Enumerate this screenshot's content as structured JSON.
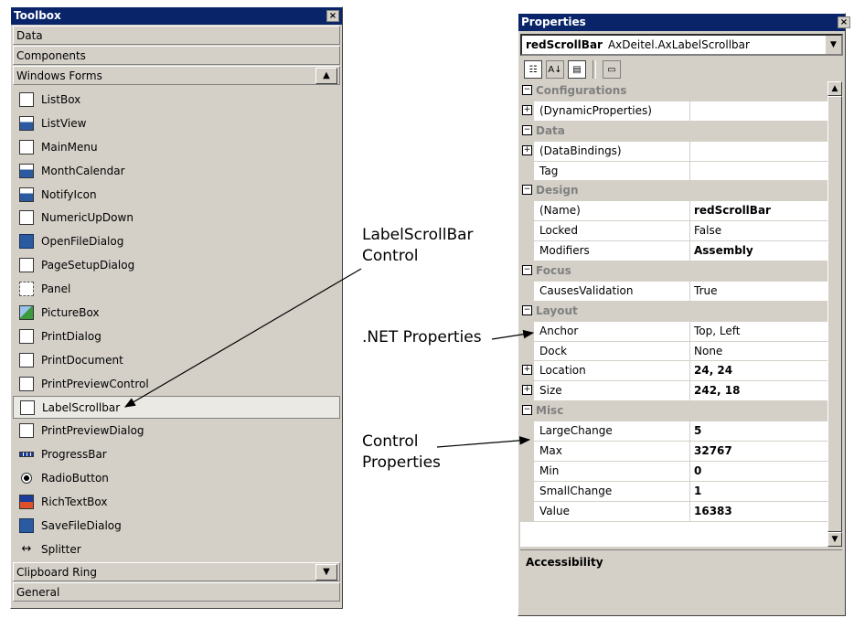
{
  "toolbox": {
    "title": "Toolbox",
    "close_glyph": "×",
    "tabs_top": [
      "Data",
      "Components",
      "Windows Forms"
    ],
    "items": [
      {
        "label": "ListBox",
        "icon": "listbox-icon"
      },
      {
        "label": "ListView",
        "icon": "listview-icon"
      },
      {
        "label": "MainMenu",
        "icon": "mainmenu-icon"
      },
      {
        "label": "MonthCalendar",
        "icon": "monthcalendar-icon"
      },
      {
        "label": "NotifyIcon",
        "icon": "notifyicon-icon"
      },
      {
        "label": "NumericUpDown",
        "icon": "numericupdown-icon"
      },
      {
        "label": "OpenFileDialog",
        "icon": "openfiledialog-icon"
      },
      {
        "label": "PageSetupDialog",
        "icon": "pagesetupdialog-icon"
      },
      {
        "label": "Panel",
        "icon": "panel-icon"
      },
      {
        "label": "PictureBox",
        "icon": "picturebox-icon"
      },
      {
        "label": "PrintDialog",
        "icon": "printdialog-icon"
      },
      {
        "label": "PrintDocument",
        "icon": "printdocument-icon"
      },
      {
        "label": "PrintPreviewControl",
        "icon": "printpreviewcontrol-icon"
      },
      {
        "label": "LabelScrollbar",
        "icon": "labelscrollbar-icon",
        "selected": true
      },
      {
        "label": "PrintPreviewDialog",
        "icon": "printpreviewdialog-icon"
      },
      {
        "label": "ProgressBar",
        "icon": "progressbar-icon"
      },
      {
        "label": "RadioButton",
        "icon": "radiobutton-icon"
      },
      {
        "label": "RichTextBox",
        "icon": "richtextbox-icon"
      },
      {
        "label": "SaveFileDialog",
        "icon": "savefiledialog-icon"
      },
      {
        "label": "Splitter",
        "icon": "splitter-icon"
      }
    ],
    "tabs_bottom": [
      "Clipboard Ring",
      "General"
    ]
  },
  "properties": {
    "title": "Properties",
    "close_glyph": "×",
    "object_name": "redScrollBar",
    "object_type": "AxDeitel.AxLabelScrollbar",
    "rows": [
      {
        "type": "cat",
        "name": "Configurations",
        "sign": "⊟"
      },
      {
        "type": "prop",
        "name": "(DynamicProperties)",
        "value": "",
        "sign": "⊞"
      },
      {
        "type": "cat",
        "name": "Data",
        "sign": "⊟"
      },
      {
        "type": "prop",
        "name": "(DataBindings)",
        "value": "",
        "sign": "⊞"
      },
      {
        "type": "prop",
        "name": "Tag",
        "value": ""
      },
      {
        "type": "cat",
        "name": "Design",
        "sign": "⊟"
      },
      {
        "type": "prop",
        "name": "(Name)",
        "value": "redScrollBar",
        "bold": true
      },
      {
        "type": "prop",
        "name": "Locked",
        "value": "False"
      },
      {
        "type": "prop",
        "name": "Modifiers",
        "value": "Assembly",
        "bold": true
      },
      {
        "type": "cat",
        "name": "Focus",
        "sign": "⊟"
      },
      {
        "type": "prop",
        "name": "CausesValidation",
        "value": "True"
      },
      {
        "type": "cat",
        "name": "Layout",
        "sign": "⊟"
      },
      {
        "type": "prop",
        "name": "Anchor",
        "value": "Top, Left"
      },
      {
        "type": "prop",
        "name": "Dock",
        "value": "None"
      },
      {
        "type": "prop",
        "name": "Location",
        "value": "24, 24",
        "bold": true,
        "sign": "⊞"
      },
      {
        "type": "prop",
        "name": "Size",
        "value": "242, 18",
        "bold": true,
        "sign": "⊞"
      },
      {
        "type": "cat",
        "name": "Misc",
        "sign": "⊟"
      },
      {
        "type": "prop",
        "name": "LargeChange",
        "value": "5",
        "bold": true
      },
      {
        "type": "prop",
        "name": "Max",
        "value": "32767",
        "bold": true
      },
      {
        "type": "prop",
        "name": "Min",
        "value": "0",
        "bold": true
      },
      {
        "type": "prop",
        "name": "SmallChange",
        "value": "1",
        "bold": true
      },
      {
        "type": "prop",
        "name": "Value",
        "value": "16383",
        "bold": true
      }
    ],
    "description_title": "Accessibility"
  },
  "annotations": {
    "labelscrollbar": [
      "LabelScrollBar",
      "Control"
    ],
    "net_properties": ".NET Properties",
    "control_properties": [
      "Control",
      "Properties"
    ]
  }
}
